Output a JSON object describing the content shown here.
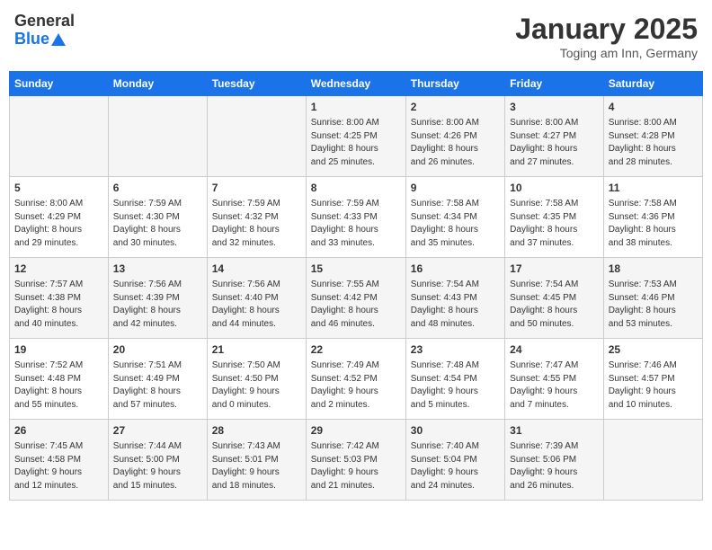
{
  "header": {
    "logo_general": "General",
    "logo_blue": "Blue",
    "title": "January 2025",
    "location": "Toging am Inn, Germany"
  },
  "days_of_week": [
    "Sunday",
    "Monday",
    "Tuesday",
    "Wednesday",
    "Thursday",
    "Friday",
    "Saturday"
  ],
  "weeks": [
    [
      {
        "day": "",
        "info": ""
      },
      {
        "day": "",
        "info": ""
      },
      {
        "day": "",
        "info": ""
      },
      {
        "day": "1",
        "info": "Sunrise: 8:00 AM\nSunset: 4:25 PM\nDaylight: 8 hours\nand 25 minutes."
      },
      {
        "day": "2",
        "info": "Sunrise: 8:00 AM\nSunset: 4:26 PM\nDaylight: 8 hours\nand 26 minutes."
      },
      {
        "day": "3",
        "info": "Sunrise: 8:00 AM\nSunset: 4:27 PM\nDaylight: 8 hours\nand 27 minutes."
      },
      {
        "day": "4",
        "info": "Sunrise: 8:00 AM\nSunset: 4:28 PM\nDaylight: 8 hours\nand 28 minutes."
      }
    ],
    [
      {
        "day": "5",
        "info": "Sunrise: 8:00 AM\nSunset: 4:29 PM\nDaylight: 8 hours\nand 29 minutes."
      },
      {
        "day": "6",
        "info": "Sunrise: 7:59 AM\nSunset: 4:30 PM\nDaylight: 8 hours\nand 30 minutes."
      },
      {
        "day": "7",
        "info": "Sunrise: 7:59 AM\nSunset: 4:32 PM\nDaylight: 8 hours\nand 32 minutes."
      },
      {
        "day": "8",
        "info": "Sunrise: 7:59 AM\nSunset: 4:33 PM\nDaylight: 8 hours\nand 33 minutes."
      },
      {
        "day": "9",
        "info": "Sunrise: 7:58 AM\nSunset: 4:34 PM\nDaylight: 8 hours\nand 35 minutes."
      },
      {
        "day": "10",
        "info": "Sunrise: 7:58 AM\nSunset: 4:35 PM\nDaylight: 8 hours\nand 37 minutes."
      },
      {
        "day": "11",
        "info": "Sunrise: 7:58 AM\nSunset: 4:36 PM\nDaylight: 8 hours\nand 38 minutes."
      }
    ],
    [
      {
        "day": "12",
        "info": "Sunrise: 7:57 AM\nSunset: 4:38 PM\nDaylight: 8 hours\nand 40 minutes."
      },
      {
        "day": "13",
        "info": "Sunrise: 7:56 AM\nSunset: 4:39 PM\nDaylight: 8 hours\nand 42 minutes."
      },
      {
        "day": "14",
        "info": "Sunrise: 7:56 AM\nSunset: 4:40 PM\nDaylight: 8 hours\nand 44 minutes."
      },
      {
        "day": "15",
        "info": "Sunrise: 7:55 AM\nSunset: 4:42 PM\nDaylight: 8 hours\nand 46 minutes."
      },
      {
        "day": "16",
        "info": "Sunrise: 7:54 AM\nSunset: 4:43 PM\nDaylight: 8 hours\nand 48 minutes."
      },
      {
        "day": "17",
        "info": "Sunrise: 7:54 AM\nSunset: 4:45 PM\nDaylight: 8 hours\nand 50 minutes."
      },
      {
        "day": "18",
        "info": "Sunrise: 7:53 AM\nSunset: 4:46 PM\nDaylight: 8 hours\nand 53 minutes."
      }
    ],
    [
      {
        "day": "19",
        "info": "Sunrise: 7:52 AM\nSunset: 4:48 PM\nDaylight: 8 hours\nand 55 minutes."
      },
      {
        "day": "20",
        "info": "Sunrise: 7:51 AM\nSunset: 4:49 PM\nDaylight: 8 hours\nand 57 minutes."
      },
      {
        "day": "21",
        "info": "Sunrise: 7:50 AM\nSunset: 4:50 PM\nDaylight: 9 hours\nand 0 minutes."
      },
      {
        "day": "22",
        "info": "Sunrise: 7:49 AM\nSunset: 4:52 PM\nDaylight: 9 hours\nand 2 minutes."
      },
      {
        "day": "23",
        "info": "Sunrise: 7:48 AM\nSunset: 4:54 PM\nDaylight: 9 hours\nand 5 minutes."
      },
      {
        "day": "24",
        "info": "Sunrise: 7:47 AM\nSunset: 4:55 PM\nDaylight: 9 hours\nand 7 minutes."
      },
      {
        "day": "25",
        "info": "Sunrise: 7:46 AM\nSunset: 4:57 PM\nDaylight: 9 hours\nand 10 minutes."
      }
    ],
    [
      {
        "day": "26",
        "info": "Sunrise: 7:45 AM\nSunset: 4:58 PM\nDaylight: 9 hours\nand 12 minutes."
      },
      {
        "day": "27",
        "info": "Sunrise: 7:44 AM\nSunset: 5:00 PM\nDaylight: 9 hours\nand 15 minutes."
      },
      {
        "day": "28",
        "info": "Sunrise: 7:43 AM\nSunset: 5:01 PM\nDaylight: 9 hours\nand 18 minutes."
      },
      {
        "day": "29",
        "info": "Sunrise: 7:42 AM\nSunset: 5:03 PM\nDaylight: 9 hours\nand 21 minutes."
      },
      {
        "day": "30",
        "info": "Sunrise: 7:40 AM\nSunset: 5:04 PM\nDaylight: 9 hours\nand 24 minutes."
      },
      {
        "day": "31",
        "info": "Sunrise: 7:39 AM\nSunset: 5:06 PM\nDaylight: 9 hours\nand 26 minutes."
      },
      {
        "day": "",
        "info": ""
      }
    ]
  ]
}
